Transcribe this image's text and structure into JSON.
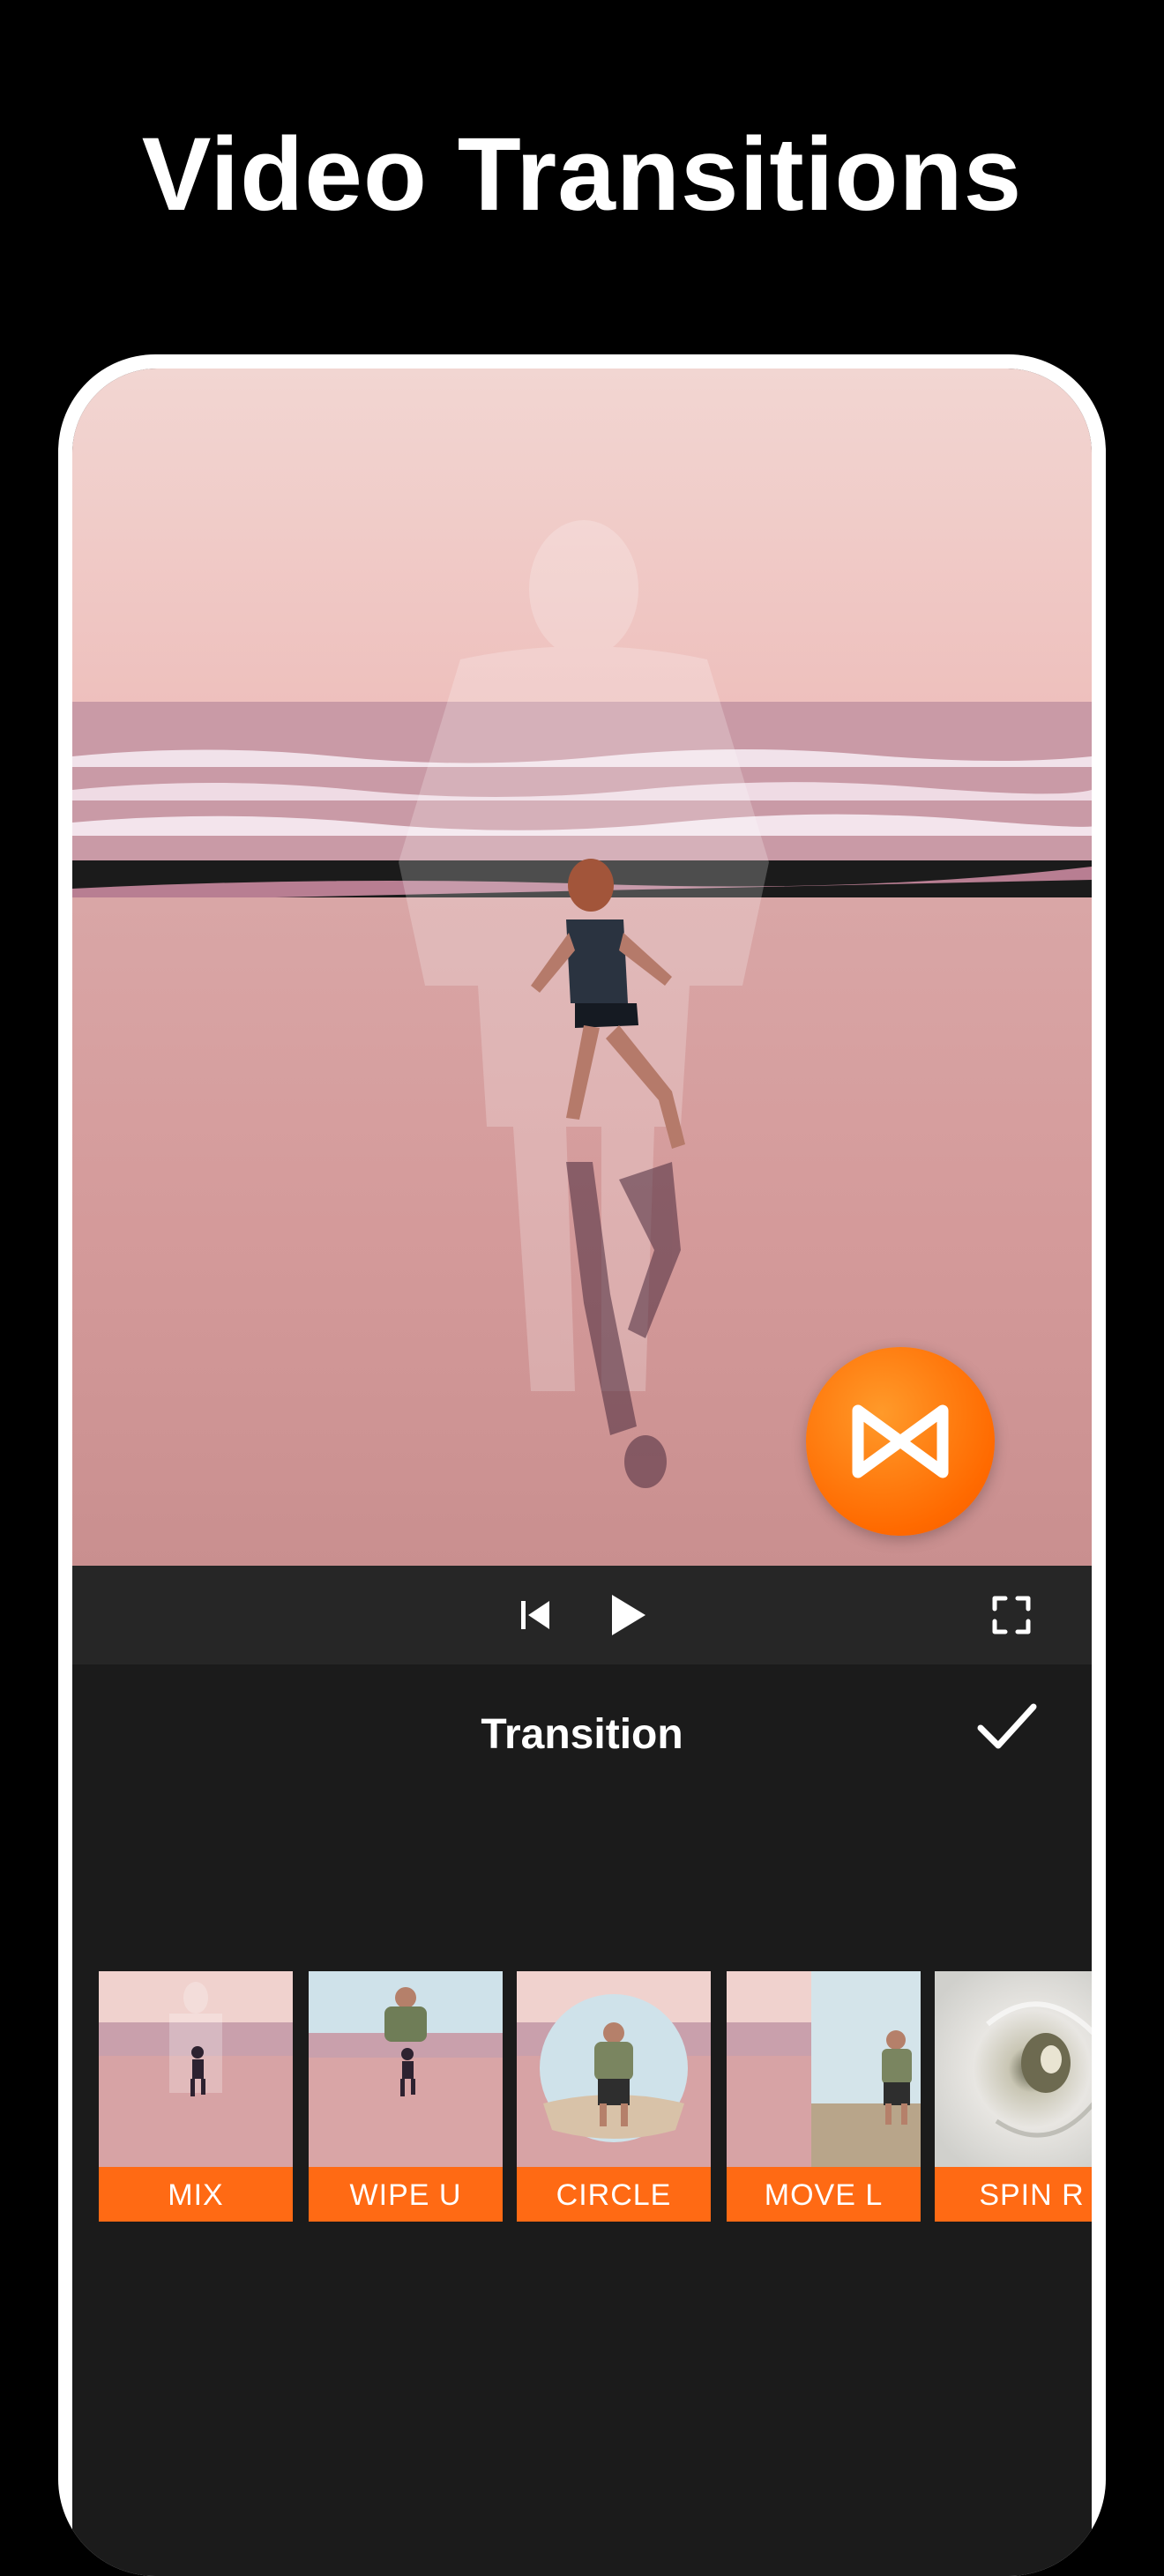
{
  "headline": "Video Transitions",
  "panel": {
    "title": "Transition"
  },
  "icons": {
    "transition": "bowtie-transition-icon",
    "skip_back": "skip-to-start-icon",
    "play": "play-icon",
    "fullscreen": "fullscreen-icon",
    "confirm": "checkmark-icon"
  },
  "transitions": [
    {
      "label": "MIX"
    },
    {
      "label": "WIPE U"
    },
    {
      "label": "CIRCLE"
    },
    {
      "label": "MOVE L"
    },
    {
      "label": "SPIN R"
    }
  ],
  "colors": {
    "accent": "#ff6a14",
    "background": "#000000",
    "panel": "#1b1b1b",
    "controls": "#262626"
  }
}
